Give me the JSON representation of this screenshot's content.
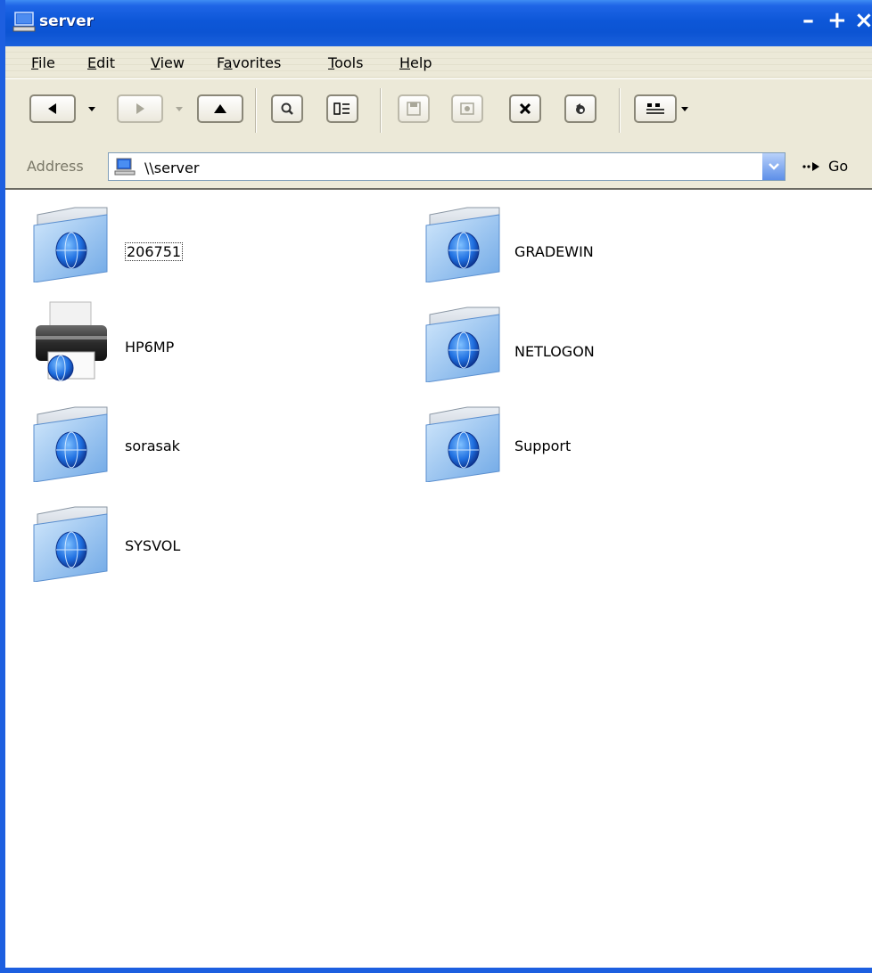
{
  "window": {
    "title": "server",
    "minimize": "–",
    "maximize": "+",
    "close": "×"
  },
  "menu": {
    "items": [
      {
        "label": "File",
        "key": "F"
      },
      {
        "label": "Edit",
        "key": "E"
      },
      {
        "label": "View",
        "key": "V"
      },
      {
        "label": "Favorites",
        "key": "a"
      },
      {
        "label": "Tools",
        "key": "T"
      },
      {
        "label": "Help",
        "key": "H"
      }
    ]
  },
  "toolbar": {
    "buttons": [
      "back",
      "forward",
      "up",
      "search",
      "folders",
      "save",
      "move-to",
      "delete",
      "undo",
      "views"
    ]
  },
  "address": {
    "label": "Address",
    "value": "\\\\server",
    "go_label": "Go"
  },
  "items": [
    {
      "name": "206751",
      "type": "shared-folder",
      "selected": true
    },
    {
      "name": "GRADEWIN",
      "type": "shared-folder"
    },
    {
      "name": "HP6MP",
      "type": "printer"
    },
    {
      "name": "NETLOGON",
      "type": "shared-folder"
    },
    {
      "name": "sorasak",
      "type": "shared-folder"
    },
    {
      "name": "Support",
      "type": "shared-folder"
    },
    {
      "name": "SYSVOL",
      "type": "shared-folder"
    }
  ],
  "colors": {
    "titlebar": "#0d57d8",
    "chrome": "#ece9d8",
    "frame": "#1d5fe0"
  }
}
